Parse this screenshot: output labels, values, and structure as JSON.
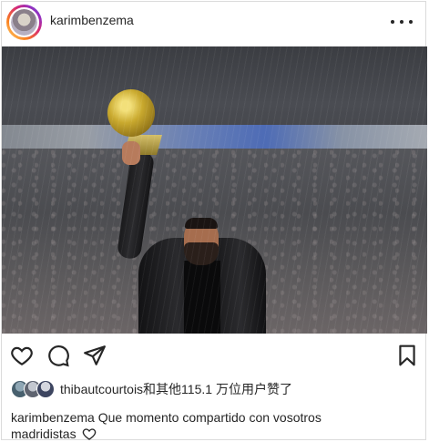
{
  "post": {
    "username": "karimbenzema",
    "likes_text": "thibautcourtois和其他115.1 万位用户赞了",
    "caption_user": "karimbenzema",
    "caption_line1": "Que momento compartido con vosotros",
    "caption_line2": "madridistas"
  },
  "icons": {
    "more": "more-horizontal-icon",
    "like": "heart-icon",
    "comment": "comment-icon",
    "share": "send-icon",
    "save": "bookmark-icon",
    "caption_heart": "heart-icon"
  },
  "colors": {
    "text": "#262626",
    "border": "#dbdbdb"
  }
}
